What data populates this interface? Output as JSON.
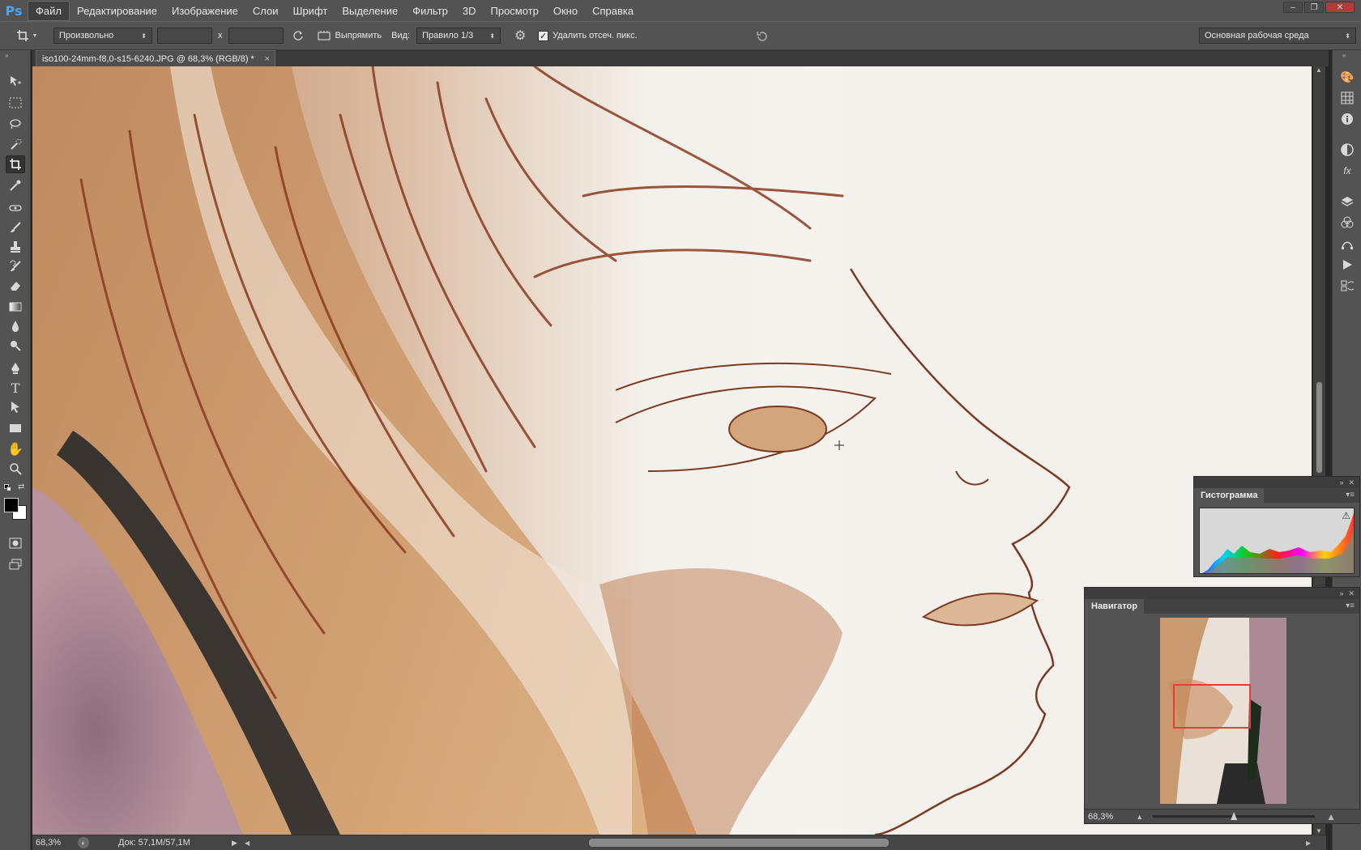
{
  "app": {
    "logo": "Ps"
  },
  "menu": [
    "Файл",
    "Редактирование",
    "Изображение",
    "Слои",
    "Шрифт",
    "Выделение",
    "Фильтр",
    "3D",
    "Просмотр",
    "Окно",
    "Справка"
  ],
  "window_controls": {
    "minimize": "–",
    "restore": "❐",
    "close": "✕"
  },
  "options": {
    "ratio": "Произвольно",
    "width_value": "",
    "height_value": "",
    "times": "x",
    "straighten": "Выпрямить",
    "view_label": "Вид:",
    "view_value": "Правило 1/3",
    "delete_cropped": "Удалить отсеч. пикс.",
    "delete_cropped_checked": true,
    "workspace": "Основная рабочая среда"
  },
  "document": {
    "tab_title": "iso100-24mm-f8,0-s15-6240.JPG @ 68,3% (RGB/8) *",
    "tab_close": "×"
  },
  "status": {
    "zoom": "68,3%",
    "doc_info": "Док: 57,1M/57,1M"
  },
  "histogram": {
    "tab": "Гистограмма",
    "warning": "⚠"
  },
  "navigator": {
    "tab": "Навигатор",
    "zoom": "68,3%"
  },
  "colors": {
    "foreground": "#000000",
    "background": "#ffffff",
    "nav_view_box": "#e83c3c"
  }
}
